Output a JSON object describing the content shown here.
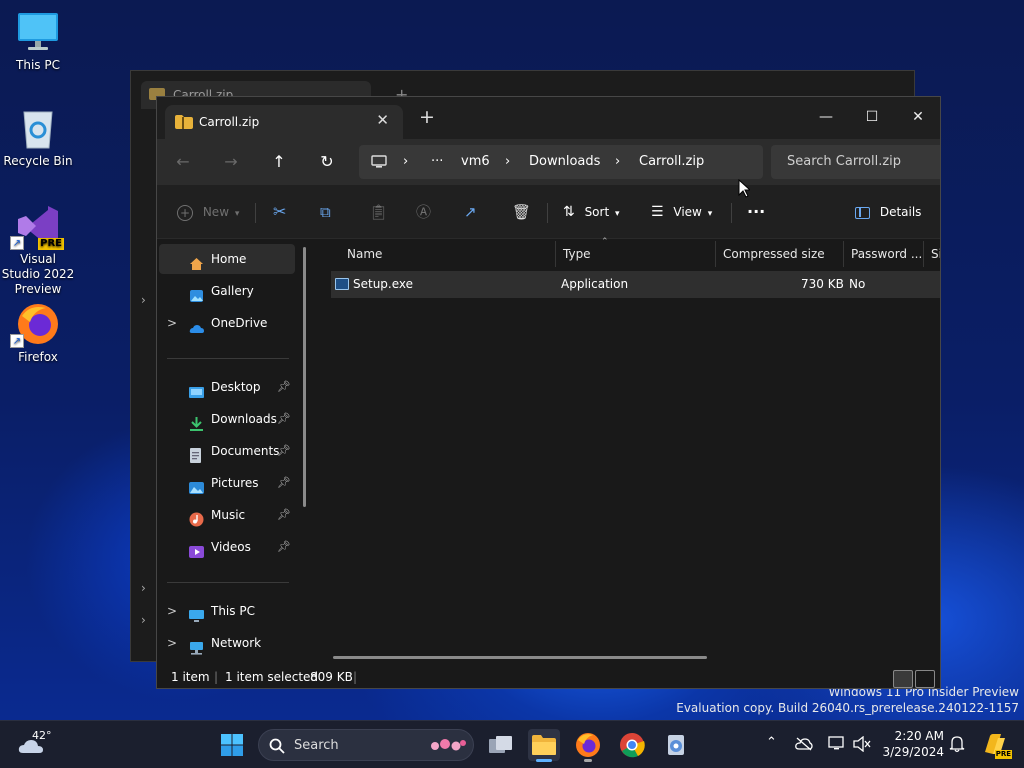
{
  "desktop": {
    "icons": [
      {
        "label": "This PC"
      },
      {
        "label": "Recycle Bin"
      },
      {
        "label": "Visual Studio 2022 Preview",
        "badge": "PRE"
      },
      {
        "label": "Firefox"
      }
    ],
    "watermark": {
      "line1": "Windows 11 Pro Insider Preview",
      "line2": "Evaluation copy. Build 26040.rs_prerelease.240122-1157"
    }
  },
  "back_window": {
    "tab_title": "Carroll.zip",
    "new_tab": "+"
  },
  "window": {
    "tab_title": "Carroll.zip",
    "tab_close": "✕",
    "new_tab": "+",
    "controls": {
      "minimize": "—",
      "maximize": "☐",
      "close": "✕"
    },
    "breadcrumb": {
      "more": "···",
      "items": [
        "vm6",
        "Downloads",
        "Carroll.zip"
      ]
    },
    "search_placeholder": "Search Carroll.zip",
    "toolbar": {
      "new_label": "New",
      "sort_label": "Sort",
      "view_label": "View",
      "more": "···",
      "details_label": "Details"
    },
    "nav": {
      "home": "Home",
      "gallery": "Gallery",
      "onedrive": "OneDrive",
      "desktop": "Desktop",
      "downloads": "Downloads",
      "documents": "Documents",
      "pictures": "Pictures",
      "music": "Music",
      "videos": "Videos",
      "thispc": "This PC",
      "network": "Network"
    },
    "columns": {
      "name": "Name",
      "type": "Type",
      "compressed": "Compressed size",
      "password": "Password ...",
      "size": "Si"
    },
    "files": [
      {
        "name": "Setup.exe",
        "type": "Application",
        "compressed": "730 KB",
        "password": "No"
      }
    ],
    "status": {
      "count": "1 item",
      "selected": "1 item selected",
      "size": "809 KB"
    }
  },
  "taskbar": {
    "weather": "42°",
    "search_label": "Search",
    "clock_time": "2:20 AM",
    "clock_date": "3/29/2024",
    "copilot_badge": "PRE"
  },
  "colors": {
    "accent": "#5fb2ff",
    "selected_row": "#2f2f2f",
    "folder": "#e8b23a"
  }
}
